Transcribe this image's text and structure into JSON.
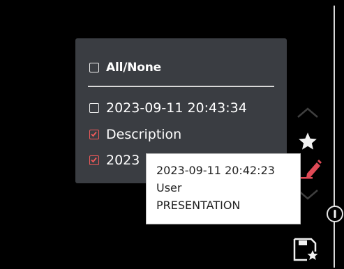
{
  "filter_panel": {
    "all_none_label": "All/None",
    "items": [
      {
        "label": "2023-09-11 20:43:34",
        "checked": false
      },
      {
        "label": "Description",
        "checked": true
      },
      {
        "label": "2023-09-11 20:42:23",
        "checked": true
      }
    ],
    "visible_partial_label": "2023"
  },
  "tooltip": {
    "line1": "2023-09-11 20:42:23",
    "line2": "User",
    "line3": "PRESENTATION"
  },
  "icons": {
    "scroll_up": "chevron-up-icon",
    "favorite": "star-icon",
    "edit": "pencil-icon",
    "scroll_down": "chevron-down-icon",
    "toggle": "slider-handle-icon",
    "save_favorite": "save-star-icon"
  },
  "colors": {
    "background": "#000000",
    "panel": "#3a3d42",
    "accent": "#f25a5a",
    "tooltip_bg": "#ffffff"
  }
}
